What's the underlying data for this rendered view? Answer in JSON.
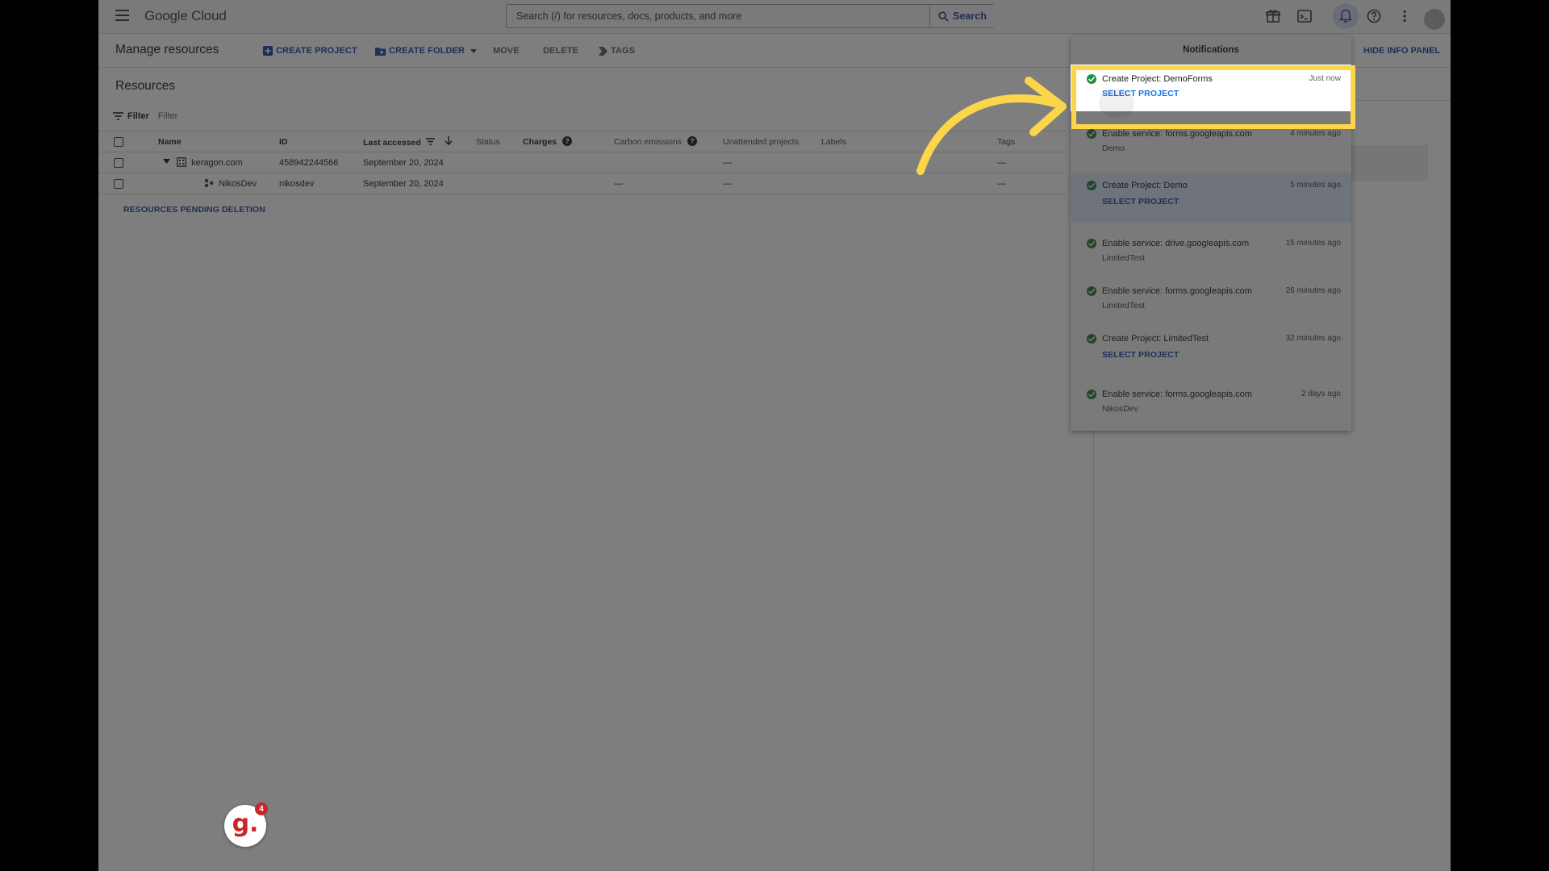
{
  "topbar": {
    "brand_google": "Google",
    "brand_cloud": "Cloud",
    "search_placeholder": "Search (/) for resources, docs, products, and more",
    "search_button": "Search"
  },
  "actionbar": {
    "title": "Manage resources",
    "create_project": "CREATE PROJECT",
    "create_folder": "CREATE FOLDER",
    "move": "MOVE",
    "delete": "DELETE",
    "tags": "TAGS",
    "hide_info_panel": "HIDE INFO PANEL"
  },
  "resources": {
    "title": "Resources",
    "filter_label": "Filter",
    "filter_placeholder": "Filter",
    "columns": {
      "name": "Name",
      "id": "ID",
      "last_accessed": "Last accessed",
      "status": "Status",
      "charges": "Charges",
      "carbon": "Carbon emissions",
      "unattended": "Unattended projects",
      "labels": "Labels",
      "tags": "Tags"
    },
    "rows": [
      {
        "name": "keragon.com",
        "id": "458942244566",
        "last_accessed": "September 20, 2024",
        "carbon": "",
        "unattended": "—",
        "tags": "—"
      },
      {
        "name": "NikosDev",
        "id": "nikosdev",
        "last_accessed": "September 20, 2024",
        "carbon": "—",
        "unattended": "—",
        "tags": "—"
      }
    ],
    "pending_deletion": "RESOURCES PENDING DELETION"
  },
  "notifications": {
    "title": "Notifications",
    "items": [
      {
        "text": "Create Project: DemoForms",
        "time": "Just now",
        "link": "SELECT PROJECT"
      },
      {
        "text": "Enable service: forms.googleapis.com",
        "time": "4 minutes ago",
        "sub": "Demo"
      },
      {
        "text": "Create Project: Demo",
        "time": "5 minutes ago",
        "link": "SELECT PROJECT"
      },
      {
        "text": "Enable service: drive.googleapis.com",
        "time": "15 minutes ago",
        "sub": "LimitedTest"
      },
      {
        "text": "Enable service: forms.googleapis.com",
        "time": "26 minutes ago",
        "sub": "LimitedTest"
      },
      {
        "text": "Create Project: LimitedTest",
        "time": "32 minutes ago",
        "link": "SELECT PROJECT"
      },
      {
        "text": "Enable service: forms.googleapis.com",
        "time": "2 days ago",
        "sub": "NikosDev"
      }
    ]
  },
  "guide_badge": {
    "letter": "g.",
    "count": "4"
  },
  "colors": {
    "highlight": "#fcd64a",
    "link": "#1a73e8",
    "success": "#1e8e3e"
  }
}
